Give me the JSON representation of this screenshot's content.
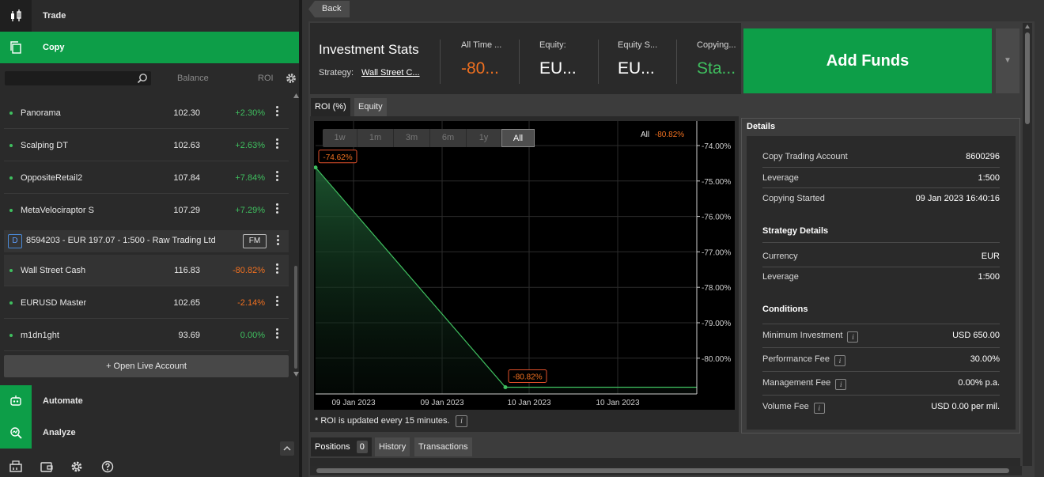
{
  "nav": {
    "trade": "Trade",
    "copy": "Copy",
    "automate": "Automate",
    "analyze": "Analyze"
  },
  "list_header": {
    "balance": "Balance",
    "roi": "ROI"
  },
  "strategies": [
    {
      "name": "Panorama",
      "balance": "102.30",
      "roi": "+2.30%",
      "roi_color": "#3fbf5f"
    },
    {
      "name": "Scalping DT",
      "balance": "102.63",
      "roi": "+2.63%",
      "roi_color": "#3fbf5f"
    },
    {
      "name": "OppositeRetail2",
      "balance": "107.84",
      "roi": "+7.84%",
      "roi_color": "#3fbf5f"
    },
    {
      "name": "MetaVelociraptor S",
      "balance": "107.29",
      "roi": "+7.29%",
      "roi_color": "#3fbf5f"
    }
  ],
  "account": {
    "badge": "D",
    "label": "8594203 - EUR 197.07 - 1:500 - Raw Trading Ltd",
    "fm": "FM"
  },
  "copied": [
    {
      "name": "Wall Street Cash",
      "balance": "116.83",
      "roi": "-80.82%",
      "roi_color": "#f07020"
    },
    {
      "name": "EURUSD Master",
      "balance": "102.65",
      "roi": "-2.14%",
      "roi_color": "#f07020"
    },
    {
      "name": "m1dn1ght",
      "balance": "93.69",
      "roi": "0.00%",
      "roi_color": "#3fbf5f"
    }
  ],
  "open_live": "+ Open Live Account",
  "back": "Back",
  "stats": {
    "title": "Investment Stats",
    "strategy_label": "Strategy:",
    "strategy_value": "Wall Street C...",
    "all_time_label": "All Time ...",
    "all_time_value": "-80...",
    "equity_label": "Equity:",
    "equity_value": "EU...",
    "equity_s_label": "Equity S...",
    "equity_s_value": "EU...",
    "copying_label": "Copying...",
    "copying_value": "Sta..."
  },
  "add_funds": "Add Funds",
  "chart_tabs": {
    "roi": "ROI (%)",
    "equity": "Equity"
  },
  "range_buttons": [
    "1w",
    "1m",
    "3m",
    "6m",
    "1y",
    "All"
  ],
  "chart_legend": {
    "period": "All",
    "value": "-80.82%"
  },
  "chart_data": {
    "type": "area",
    "x": [
      "09 Jan 2023",
      "10 Jan 2023"
    ],
    "x_ticks": [
      "09 Jan 2023",
      "09 Jan 2023",
      "10 Jan 2023",
      "10 Jan 2023"
    ],
    "y_ticks": [
      "-74.00%",
      "-75.00%",
      "-76.00%",
      "-77.00%",
      "-78.00%",
      "-79.00%",
      "-80.00%"
    ],
    "ylim": [
      -80.85,
      -73.9
    ],
    "series": [
      {
        "values": [
          -74.62,
          -80.82,
          -80.82
        ]
      }
    ],
    "labels": [
      "-74.62%",
      "-80.82%"
    ],
    "grid": true,
    "color": "#3fbf5f"
  },
  "roi_note": "* ROI is updated every 15 minutes.",
  "details": {
    "title": "Details",
    "rows1": [
      {
        "k": "Copy Trading Account",
        "v": "8600296"
      },
      {
        "k": "Leverage",
        "v": "1:500"
      },
      {
        "k": "Copying Started",
        "v": "09 Jan 2023 16:40:16"
      }
    ],
    "strategy_title": "Strategy Details",
    "rows2": [
      {
        "k": "Currency",
        "v": "EUR"
      },
      {
        "k": "Leverage",
        "v": "1:500"
      }
    ],
    "conditions_title": "Conditions",
    "rows3": [
      {
        "k": "Minimum Investment",
        "v": "USD 650.00"
      },
      {
        "k": "Performance Fee",
        "v": "30.00%"
      },
      {
        "k": "Management Fee",
        "v": "0.00% p.a."
      },
      {
        "k": "Volume Fee",
        "v": "USD 0.00 per mil."
      }
    ],
    "info": "i"
  },
  "bottom_tabs": {
    "positions": "Positions",
    "positions_count": "0",
    "history": "History",
    "transactions": "Transactions"
  }
}
